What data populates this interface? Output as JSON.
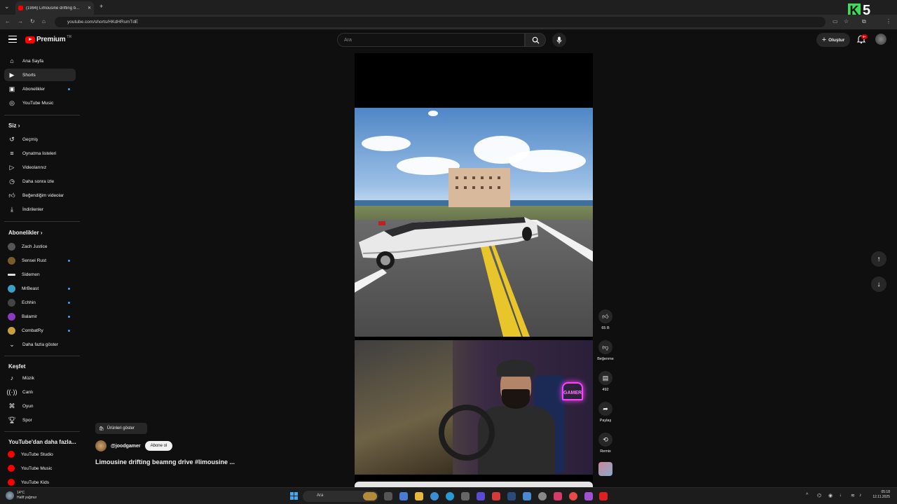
{
  "browser": {
    "tab_title": "(1994) Limousine drifting b...",
    "url": "youtube.com/shorts/HKdHRsmTdE"
  },
  "brand_overlay": {
    "number": "5",
    "letter": "K"
  },
  "header": {
    "logo_text": "Premium",
    "logo_region": "TR",
    "search_placeholder": "Ara",
    "create_label": "Oluştur",
    "notif_badge": "9+"
  },
  "sidebar": {
    "main": [
      {
        "label": "Ana Sayfa",
        "icon": "home-icon"
      },
      {
        "label": "Shorts",
        "icon": "shorts-icon"
      },
      {
        "label": "Abonelikler",
        "icon": "subscriptions-icon"
      },
      {
        "label": "YouTube Music",
        "icon": "music-icon"
      }
    ],
    "you_heading": "Siz",
    "you": [
      {
        "label": "Geçmiş",
        "icon": "history-icon"
      },
      {
        "label": "Oynatma listeleri",
        "icon": "playlists-icon"
      },
      {
        "label": "Videolarınız",
        "icon": "your-videos-icon"
      },
      {
        "label": "Daha sonra izle",
        "icon": "watch-later-icon"
      },
      {
        "label": "Beğendiğim videolar",
        "icon": "liked-icon"
      },
      {
        "label": "İndirilenler",
        "icon": "downloads-icon"
      }
    ],
    "subs_heading": "Abonelikler",
    "subs": [
      {
        "label": "Zach Justice",
        "color": "#555555",
        "dot": false
      },
      {
        "label": "Sensei Rust",
        "color": "#7a5a2a",
        "dot": true
      },
      {
        "label": "Sidemen",
        "color": "#dddddd",
        "dot": false
      },
      {
        "label": "MrBeast",
        "color": "#3aa0c8",
        "dot": true
      },
      {
        "label": "Echhin",
        "color": "#444444",
        "dot": true
      },
      {
        "label": "Balamir",
        "color": "#8a3ac0",
        "dot": true
      },
      {
        "label": "CombatRy",
        "color": "#c8a03a",
        "dot": true
      }
    ],
    "show_more": "Daha fazla göster",
    "explore_heading": "Keşfet",
    "explore": [
      {
        "label": "Müzik",
        "icon": "music-note-icon"
      },
      {
        "label": "Canlı",
        "icon": "live-icon"
      },
      {
        "label": "Oyun",
        "icon": "gaming-icon"
      },
      {
        "label": "Spor",
        "icon": "trophy-icon"
      }
    ],
    "more_heading": "YouTube'dan daha fazla...",
    "more": [
      {
        "label": "YouTube Studio"
      },
      {
        "label": "YouTube Music"
      },
      {
        "label": "YouTube Kids"
      }
    ]
  },
  "short": {
    "products_label": "Ürünleri göster",
    "channel": "@joodgamer",
    "subscribe_label": "Abone ol",
    "title": "Limousine drifting beamng drive #limousine ...",
    "camera_neon_text": "GAMER"
  },
  "actions": {
    "like_count": "65 B",
    "dislike_label": "Beğenme",
    "comments_count": "492",
    "share_label": "Paylaş",
    "remix_label": "Remix"
  },
  "taskbar": {
    "temp": "14°C",
    "weather": "Hafif yağmur",
    "search": "Ara",
    "time": "05:18",
    "date": "12.11.2025"
  }
}
